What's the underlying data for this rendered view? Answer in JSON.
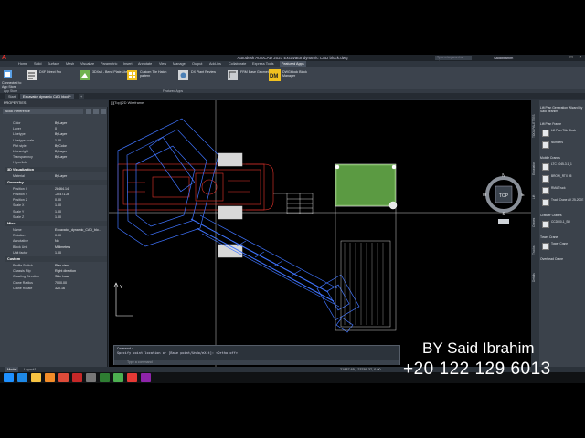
{
  "window": {
    "title": "Autodesk AutoCAD 2021   Excavator dynamic CAD block.dwg",
    "search_placeholder": "Type a keyword or phrase",
    "user": "SaidIbrahim"
  },
  "ribbon": {
    "tabs": [
      "Home",
      "Solid",
      "Surface",
      "Mesh",
      "Visualize",
      "Parametric",
      "Insert",
      "Annotate",
      "View",
      "Manage",
      "Output",
      "Add-ins",
      "Collaborate",
      "Express Tools",
      "Featured Apps"
    ],
    "active_tab": "Featured Apps",
    "buttons": [
      {
        "label": "Connected to App Store",
        "icon": "app-store-icon"
      },
      {
        "label": "DXF Direct Pro",
        "icon": "dxf-icon"
      },
      {
        "label": "3DXsd - Bend Plate Lite",
        "icon": "bend-plate-icon"
      },
      {
        "label": "Custom Tile Hatch pattern",
        "icon": "hatch-icon"
      },
      {
        "label": "DX Plant Review",
        "icon": "plant-review-icon"
      },
      {
        "label": "FRM Base Geometry",
        "icon": "frm-icon"
      },
      {
        "label": "DWGblock Block Manager",
        "icon": "block-manager-icon"
      }
    ],
    "footer_left": "App Store",
    "footer_center": "Featured Apps",
    "colors": {
      "accent": "#f0c020",
      "logo": "#e8322c"
    }
  },
  "file_tabs": [
    "Start",
    "Excavator dynamic CAD block*"
  ],
  "properties": {
    "title": "PROPERTIES",
    "selection": "Block Reference",
    "general": [
      {
        "key": "Color",
        "value": "ByLayer"
      },
      {
        "key": "Layer",
        "value": "0"
      },
      {
        "key": "Linetype",
        "value": "ByLayer"
      },
      {
        "key": "Linetype scale",
        "value": "1.00"
      },
      {
        "key": "Plot style",
        "value": "ByColor"
      },
      {
        "key": "Lineweight",
        "value": "ByLayer"
      },
      {
        "key": "Transparency",
        "value": "ByLayer"
      },
      {
        "key": "Hyperlink",
        "value": ""
      }
    ],
    "viz_title": "3D Visualization",
    "viz": [
      {
        "key": "Material",
        "value": "ByLayer"
      }
    ],
    "geometry_title": "Geometry",
    "geometry": [
      {
        "key": "Position X",
        "value": "28464.14"
      },
      {
        "key": "Position Y",
        "value": "-22471.26"
      },
      {
        "key": "Position Z",
        "value": "0.00"
      },
      {
        "key": "Scale X",
        "value": "1.00"
      },
      {
        "key": "Scale Y",
        "value": "1.00"
      },
      {
        "key": "Scale Z",
        "value": "1.00"
      }
    ],
    "misc_title": "Misc",
    "misc": [
      {
        "key": "Name",
        "value": "Excavator_dynamic_CAD_blo..."
      },
      {
        "key": "Rotation",
        "value": "0.00"
      },
      {
        "key": "Annotative",
        "value": "No"
      },
      {
        "key": "Block Unit",
        "value": "Millimeters"
      },
      {
        "key": "Unit factor",
        "value": "1.00"
      }
    ],
    "custom_title": "Custom",
    "custom": [
      {
        "key": "Profile Switch",
        "value": "Plan view"
      },
      {
        "key": "Chassis Flip",
        "value": "Right direction"
      },
      {
        "key": "Crawling Direction",
        "value": "Side Load"
      },
      {
        "key": "Crane Radius",
        "value": "7000.00"
      },
      {
        "key": "Crane Rotate",
        "value": "320.16"
      }
    ]
  },
  "viewport": {
    "label": "[-][Top][2D Wireframe]",
    "viewcube_top": "TOP",
    "compass": {
      "n": "N",
      "s": "S",
      "e": "E",
      "w": "W"
    },
    "ucs_y": "Y"
  },
  "command": {
    "lines": [
      "Command:",
      "Specify point location or [Base point/Undo/eXit]: <Ortho off>"
    ],
    "input_placeholder": "Type a command"
  },
  "statusbar": {
    "tabs": [
      "Model",
      "Layout1"
    ],
    "active": "Model",
    "coords": "21887.65, -23789.37, 0.00"
  },
  "tool_palettes": {
    "title": "TOOL PALETTES",
    "vertical_tabs": [
      "Excavator",
      "Lift",
      "Cranes",
      "Trucks",
      "Details"
    ],
    "sections": [
      {
        "title": "Lift Plan Generation Wizard By Said Ibrahim",
        "items": []
      },
      {
        "title": "Lift Plan Frame",
        "items": [
          "Lift Plan Title Block",
          "Numbers"
        ]
      },
      {
        "title": "Mobile Cranes",
        "items": [
          "LTC 1045-3.1_1",
          "BROW_RTX 95",
          "RMA Truck",
          "Truck Crane AK 25-200E"
        ]
      },
      {
        "title": "Crawler Cranes",
        "items": [
          "CC2800-1_SH"
        ]
      },
      {
        "title": "Tower Crane",
        "items": [
          "Tower Crane"
        ]
      },
      {
        "title": "Overhead Crane",
        "items": []
      }
    ]
  },
  "taskbar": {
    "apps": [
      {
        "icon": "windows-start-icon",
        "color": "#1e90ff"
      },
      {
        "icon": "ie-icon",
        "color": "#1e88e5"
      },
      {
        "icon": "explorer-icon",
        "color": "#f6c342"
      },
      {
        "icon": "media-player-icon",
        "color": "#f28c28"
      },
      {
        "icon": "chrome-icon",
        "color": "#dd4b39"
      },
      {
        "icon": "autocad-icon",
        "color": "#c62828"
      },
      {
        "icon": "grid-app-icon",
        "color": "#777777"
      },
      {
        "icon": "excel-icon",
        "color": "#2e7d32"
      },
      {
        "icon": "camtasia-icon",
        "color": "#4caf50"
      },
      {
        "icon": "record-icon",
        "color": "#e53935"
      },
      {
        "icon": "video-editor-icon",
        "color": "#8e24aa"
      }
    ]
  },
  "overlay": {
    "name": "BY Said Ibrahim",
    "phone": "+20 122 129 6013"
  }
}
